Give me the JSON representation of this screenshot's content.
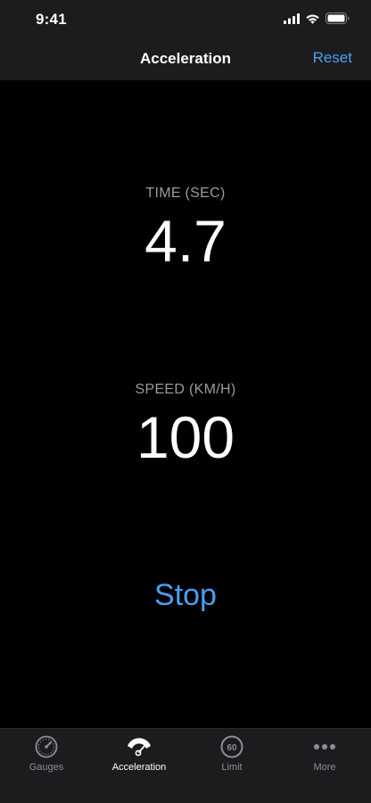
{
  "status_bar": {
    "time": "9:41",
    "icons": [
      "cellular-signal-icon",
      "wifi-icon",
      "battery-icon"
    ]
  },
  "nav": {
    "title": "Acceleration",
    "reset_label": "Reset"
  },
  "metrics": {
    "time": {
      "label": "TIME (SEC)",
      "value": "4.7"
    },
    "speed": {
      "label": "SPEED (KM/H)",
      "value": "100"
    }
  },
  "actions": {
    "stop_label": "Stop"
  },
  "tabs": [
    {
      "label": "Gauges",
      "icon": "speedometer-gauge-icon",
      "active": false
    },
    {
      "label": "Acceleration",
      "icon": "acceleration-gauge-icon",
      "active": true
    },
    {
      "label": "Limit",
      "icon": "speed-limit-60-icon",
      "active": false,
      "icon_text": "60"
    },
    {
      "label": "More",
      "icon": "more-dots-icon",
      "active": false
    }
  ],
  "colors": {
    "accent": "#4a9ff0",
    "background": "#000000",
    "bar_background": "#1c1c1e",
    "label_gray": "#9b9ba0",
    "tab_inactive": "#8e8e93"
  }
}
